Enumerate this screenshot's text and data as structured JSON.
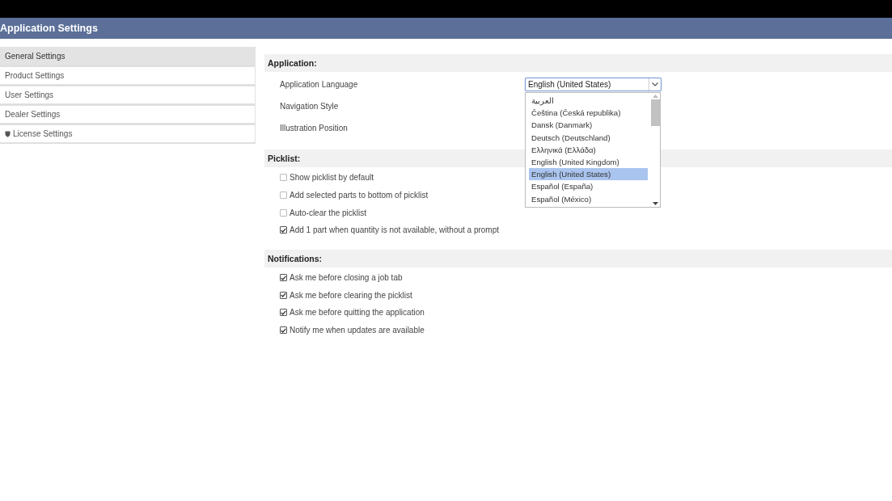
{
  "title_bar": {
    "title": "Application Settings"
  },
  "sidebar": {
    "items": [
      {
        "label": "General Settings",
        "selected": true,
        "kind": "plain"
      },
      {
        "label": "Product Settings",
        "selected": false,
        "kind": "plain"
      },
      {
        "label": "User Settings",
        "selected": false,
        "kind": "plain"
      },
      {
        "label": "Dealer Settings",
        "selected": false,
        "kind": "plain"
      },
      {
        "label": "License Settings",
        "selected": false,
        "kind": "shield"
      }
    ]
  },
  "sections": [
    {
      "heading": "Application:",
      "kind": "fields",
      "fields": [
        {
          "label": "Application Language",
          "dropdown": {
            "value": "English (United States)",
            "expanded": true,
            "options": [
              {
                "label": "العربية",
                "selected": false
              },
              {
                "label": "Čeština (Česká republika)",
                "selected": false
              },
              {
                "label": "Dansk (Danmark)",
                "selected": false
              },
              {
                "label": "Deutsch (Deutschland)",
                "selected": false
              },
              {
                "label": "Ελληνικά (Ελλάδα)",
                "selected": false
              },
              {
                "label": "English (United Kingdom)",
                "selected": false
              },
              {
                "label": "English (United States)",
                "selected": true
              },
              {
                "label": "Español (España)",
                "selected": false
              },
              {
                "label": "Español (México)",
                "selected": false
              }
            ]
          }
        },
        {
          "label": "Navigation Style"
        },
        {
          "label": "Illustration Position"
        }
      ]
    },
    {
      "heading": "Picklist:",
      "kind": "checks",
      "items": [
        {
          "label": "Show picklist by default",
          "checked": false
        },
        {
          "label": "Add selected parts to bottom of picklist",
          "checked": false
        },
        {
          "label": "Auto-clear the picklist",
          "checked": false
        },
        {
          "label": "Add 1 part when quantity is not available, without a prompt",
          "checked": true
        }
      ]
    },
    {
      "heading": "Notifications:",
      "kind": "checks",
      "items": [
        {
          "label": "Ask me before closing a job tab",
          "checked": true
        },
        {
          "label": "Ask me before clearing the picklist",
          "checked": true
        },
        {
          "label": "Ask me before quitting the application",
          "checked": true
        },
        {
          "label": "Notify me when updates are available",
          "checked": true
        }
      ]
    }
  ]
}
